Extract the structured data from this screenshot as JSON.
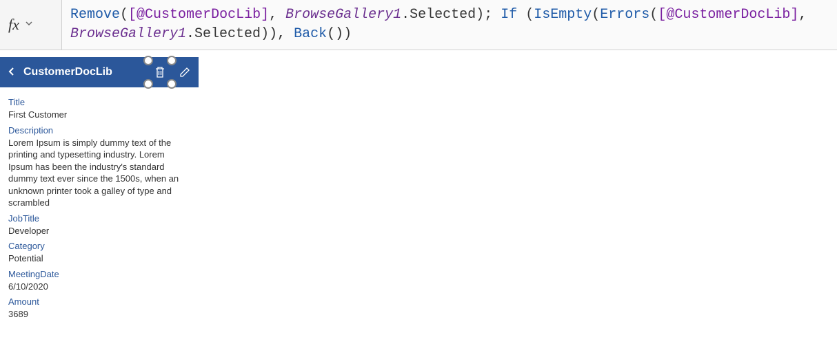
{
  "formulaBar": {
    "fxLabel": "fx",
    "tokens": {
      "remove": "Remove",
      "dataSourcePrefix": "[@",
      "dataSourceName": "CustomerDocLib",
      "dataSourceSuffix": "]",
      "gallery": "BrowseGallery1",
      "selected": ".Selected",
      "if": "If",
      "isEmpty": "IsEmpty",
      "errors": "Errors",
      "back": "Back",
      "openParen": "(",
      "closeParen": ")",
      "comma": ", ",
      "semicolon": "; "
    }
  },
  "header": {
    "title": "CustomerDocLib"
  },
  "fields": [
    {
      "label": "Title",
      "value": "First Customer"
    },
    {
      "label": "Description",
      "value": "Lorem Ipsum is simply dummy text of the printing and typesetting industry. Lorem Ipsum has been the industry's standard dummy text ever since the 1500s, when an unknown printer took a galley of type and scrambled"
    },
    {
      "label": "JobTitle",
      "value": "Developer"
    },
    {
      "label": "Category",
      "value": "Potential"
    },
    {
      "label": "MeetingDate",
      "value": "6/10/2020"
    },
    {
      "label": "Amount",
      "value": "3689"
    }
  ]
}
